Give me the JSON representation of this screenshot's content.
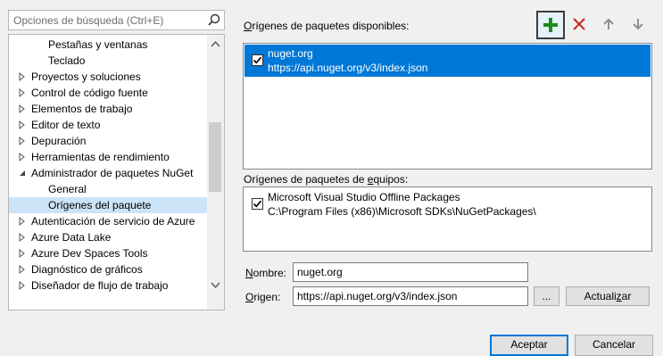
{
  "search": {
    "placeholder": "Opciones de búsqueda (Ctrl+E)",
    "icon": "search-icon"
  },
  "tree": {
    "items": [
      {
        "label": "Pestañas y ventanas",
        "level": 1,
        "expander": "none"
      },
      {
        "label": "Teclado",
        "level": 1,
        "expander": "none"
      },
      {
        "label": "Proyectos y soluciones",
        "level": 0,
        "expander": "collapsed"
      },
      {
        "label": "Control de código fuente",
        "level": 0,
        "expander": "collapsed"
      },
      {
        "label": "Elementos de trabajo",
        "level": 0,
        "expander": "collapsed"
      },
      {
        "label": "Editor de texto",
        "level": 0,
        "expander": "collapsed"
      },
      {
        "label": "Depuración",
        "level": 0,
        "expander": "collapsed"
      },
      {
        "label": "Herramientas de rendimiento",
        "level": 0,
        "expander": "collapsed"
      },
      {
        "label": "Administrador de paquetes NuGet",
        "level": 0,
        "expander": "expanded"
      },
      {
        "label": "General",
        "level": 1,
        "expander": "none"
      },
      {
        "label": "Orígenes del paquete",
        "level": 1,
        "expander": "none",
        "selected": true
      },
      {
        "label": "Autenticación de servicio de Azure",
        "level": 0,
        "expander": "collapsed"
      },
      {
        "label": "Azure Data Lake",
        "level": 0,
        "expander": "collapsed"
      },
      {
        "label": "Azure Dev Spaces Tools",
        "level": 0,
        "expander": "collapsed"
      },
      {
        "label": "Diagnóstico de gráficos",
        "level": 0,
        "expander": "collapsed"
      },
      {
        "label": "Diseñador de flujo de trabajo",
        "level": 0,
        "expander": "collapsed"
      }
    ]
  },
  "available": {
    "title_pre": "",
    "title_u": "O",
    "title_post": "rígenes de paquetes disponibles:",
    "sources": [
      {
        "name": "nuget.org",
        "url": "https://api.nuget.org/v3/index.json",
        "checked": true,
        "selected": true
      }
    ]
  },
  "toolbar": {
    "add_icon": "plus-icon",
    "remove_icon": "x-icon",
    "up_icon": "arrow-up-icon",
    "down_icon": "arrow-down-icon",
    "colors": {
      "add": "#1e8b1e",
      "remove": "#c42b1c",
      "disabled": "#8e8e8e"
    }
  },
  "machine": {
    "title_pre": "Orígenes de paquetes de ",
    "title_u": "e",
    "title_post": "quipos:",
    "sources": [
      {
        "name": "Microsoft Visual Studio Offline Packages",
        "url": "C:\\Program Files (x86)\\Microsoft SDKs\\NuGetPackages\\",
        "checked": true,
        "selected": false
      }
    ]
  },
  "form": {
    "name_label_u": "N",
    "name_label_rest": "ombre:",
    "name_value": "nuget.org",
    "source_label_u": "O",
    "source_label_rest": "rigen:",
    "source_value": "https://api.nuget.org/v3/index.json",
    "browse_label": "...",
    "update_label_pre": "Actuali",
    "update_label_u": "z",
    "update_label_post": "ar"
  },
  "footer": {
    "ok_label": "Aceptar",
    "cancel_label": "Cancelar"
  },
  "colors": {
    "selection": "#0078d7",
    "tree_selection": "#cce4f7"
  }
}
